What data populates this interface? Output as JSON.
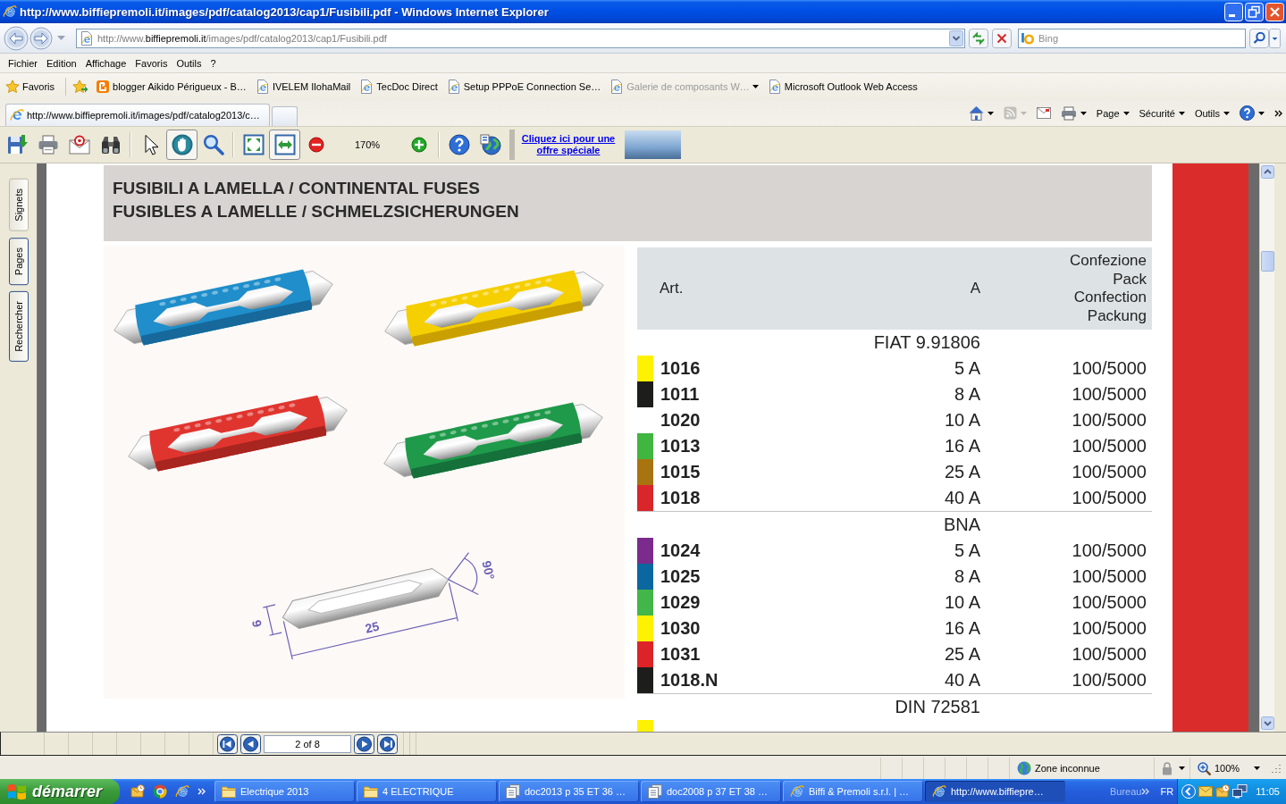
{
  "window": {
    "title": "http://www.biffiepremoli.it/images/pdf/catalog2013/cap1/Fusibili.pdf - Windows Internet Explorer"
  },
  "address_bar": {
    "url_start": "http://www.",
    "url_domain": "biffiepremoli.it",
    "url_rest": "/images/pdf/catalog2013/cap1/Fusibili.pdf"
  },
  "search": {
    "placeholder": "Bing"
  },
  "menu": [
    "Fichier",
    "Edition",
    "Affichage",
    "Favoris",
    "Outils",
    "?"
  ],
  "favorites_bar": {
    "label": "Favoris",
    "links": [
      {
        "label": "blogger Aikido Périgueux - B…",
        "kind": "blog",
        "disabled": false
      },
      {
        "label": "IVELEM IlohaMail",
        "kind": "page",
        "disabled": false
      },
      {
        "label": "TecDoc Direct",
        "kind": "page",
        "disabled": false
      },
      {
        "label": "Setup PPPoE Connection Se…",
        "kind": "page",
        "disabled": false
      },
      {
        "label": "Galerie de composants W…",
        "kind": "gallery",
        "disabled": true
      },
      {
        "label": "Microsoft Outlook Web Access",
        "kind": "page",
        "disabled": false
      }
    ]
  },
  "tabs": [
    {
      "label": "http://www.biffiepremoli.it/images/pdf/catalog2013/c…",
      "selected": true
    }
  ],
  "command_bar": {
    "feeds_disabled": true,
    "menus": [
      "Page",
      "Sécurité",
      "Outils"
    ]
  },
  "pdf_toolbar": {
    "tool_groups": [
      [
        {
          "kind": "save",
          "selected": false
        },
        {
          "kind": "print",
          "selected": false
        },
        {
          "kind": "email",
          "selected": false
        },
        {
          "kind": "find",
          "selected": false
        }
      ],
      [
        {
          "kind": "select",
          "selected": false
        },
        {
          "kind": "hand",
          "selected": true
        },
        {
          "kind": "zoom",
          "selected": false
        }
      ],
      [
        {
          "kind": "fit-page",
          "selected": false
        },
        {
          "kind": "fit-width",
          "selected": true
        },
        {
          "kind": "zoom-out",
          "selected": false
        },
        {
          "kind": "zoom-value",
          "label": "170%"
        },
        {
          "kind": "zoom-in",
          "selected": false
        }
      ],
      [
        {
          "kind": "help",
          "selected": false
        },
        {
          "kind": "update",
          "selected": false
        }
      ]
    ],
    "promo_link": "Cliquez ici pour une offre spéciale"
  },
  "side_tabs": [
    {
      "label": "Signets",
      "enabled": false
    },
    {
      "label": "Pages",
      "enabled": true
    },
    {
      "label": "Rechercher",
      "enabled": true
    }
  ],
  "document": {
    "title_lines": [
      "FUSIBILI A LAMELLA / CONTINENTAL FUSES",
      "FUSIBLES A LAMELLE / SCHMELZSICHERUNGEN"
    ],
    "diagram_labels": [
      "6",
      "25",
      "90°"
    ],
    "table": {
      "columns": [
        "Art.",
        "A",
        "Confezione Pack Confection Packung"
      ],
      "groups": [
        {
          "name": "FIAT 9.91806",
          "rows": [
            {
              "art": "1016",
              "amps": "5 A",
              "pack": "100/5000",
              "color": "#fff200"
            },
            {
              "art": "1011",
              "amps": "8 A",
              "pack": "100/5000",
              "color": "#1d1d1b"
            },
            {
              "art": "1020",
              "amps": "10 A",
              "pack": "100/5000"
            },
            {
              "art": "1013",
              "amps": "16 A",
              "pack": "100/5000",
              "color": "#40b540"
            },
            {
              "art": "1015",
              "amps": "25 A",
              "pack": "100/5000",
              "color": "#a87410"
            },
            {
              "art": "1018",
              "amps": "40 A",
              "pack": "100/5000",
              "color": "#d9262b"
            }
          ]
        },
        {
          "name": "BNA",
          "rows": [
            {
              "art": "1024",
              "amps": "5 A",
              "pack": "100/5000",
              "color": "#7b2b8c"
            },
            {
              "art": "1025",
              "amps": "8 A",
              "pack": "100/5000",
              "color": "#0a67a0"
            },
            {
              "art": "1029",
              "amps": "10 A",
              "pack": "100/5000",
              "color": "#42b649"
            },
            {
              "art": "1030",
              "amps": "16 A",
              "pack": "100/5000",
              "color": "#fff200"
            },
            {
              "art": "1031",
              "amps": "25 A",
              "pack": "100/5000",
              "color": "#dc2428"
            },
            {
              "art": "1018.N",
              "amps": "40 A",
              "pack": "100/5000",
              "color": "#1d1d1b"
            }
          ]
        },
        {
          "name": "DIN 72581",
          "rows": [
            {
              "color": "#fff200"
            }
          ]
        }
      ]
    }
  },
  "page_navigation": {
    "page": "2 of 8"
  },
  "status_bar": {
    "zone": "Zone inconnue",
    "zoom": "100%"
  },
  "taskbar": {
    "start": "démarrer",
    "tasks": [
      {
        "label": "Electrique 2013",
        "kind": "folder",
        "selected": false
      },
      {
        "label": "4 ELECTRIQUE",
        "kind": "folder",
        "selected": false
      },
      {
        "label": "doc2013 p 35 ET 36 …",
        "kind": "document",
        "selected": false
      },
      {
        "label": "doc2008 p 37 ET 38 …",
        "kind": "document",
        "selected": false
      },
      {
        "label": "Biffi & Premoli s.r.l. | …",
        "kind": "browser",
        "selected": false
      },
      {
        "label": "http://www.biffiepre…",
        "kind": "browser",
        "selected": true
      }
    ],
    "toolbar": "Bureau",
    "language": "FR",
    "clock": "11:05"
  }
}
